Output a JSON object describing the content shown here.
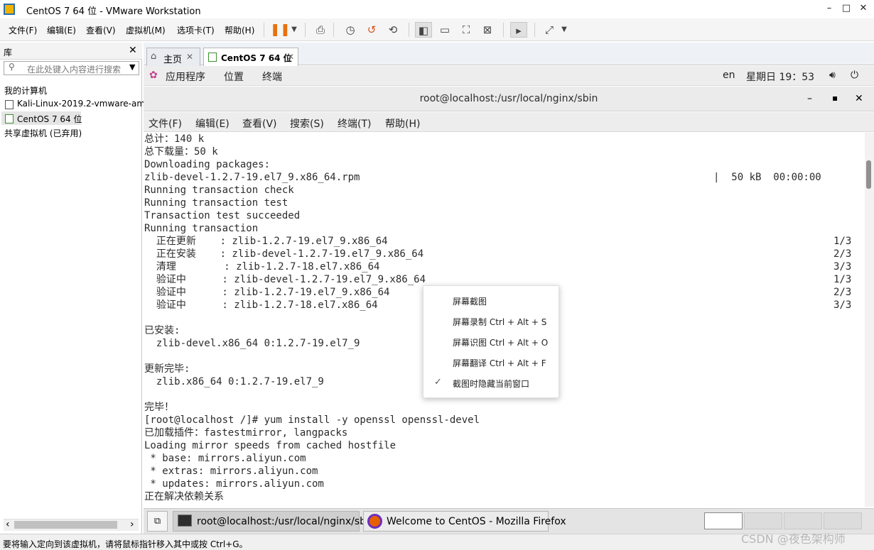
{
  "window": {
    "title": "CentOS 7 64 位 - VMware Workstation",
    "controls": [
      "–",
      "□",
      "✕"
    ]
  },
  "menubar": [
    "文件(F)",
    "编辑(E)",
    "查看(V)",
    "虚拟机(M)",
    "选项卡(T)",
    "帮助(H)"
  ],
  "library": {
    "title": "库",
    "close": "✕",
    "search_placeholder": "在此处键入内容进行搜索",
    "search_arrow": "▼",
    "items": [
      "我的计算机",
      "Kali-Linux-2019.2-vmware-am",
      "CentOS 7 64 位",
      "共享虚拟机 (已弃用)"
    ],
    "scroll_left": "‹",
    "scroll_right": "›"
  },
  "tabs": [
    {
      "label": "主页",
      "icon": "home-icon"
    },
    {
      "label": "CentOS 7 64 位",
      "icon": "vm-icon"
    }
  ],
  "gnome_bar": {
    "apps": "应用程序",
    "places": "位置",
    "terminal": "终端",
    "lang": "en",
    "clock": "星期日 19：53"
  },
  "terminal": {
    "title": "root@localhost:/usr/local/nginx/sbin",
    "controls": [
      "–",
      "▪",
      "✕"
    ],
    "menu": [
      "文件(F)",
      "编辑(E)",
      "查看(V)",
      "搜索(S)",
      "终端(T)",
      "帮助(H)"
    ],
    "lines": [
      "总计：140 k",
      "总下载量：50 k",
      "Downloading packages:",
      "zlib-devel-1.2.7-19.el7_9.x86_64.rpm",
      "Running transaction check",
      "Running transaction test",
      "Transaction test succeeded",
      "Running transaction",
      "  正在更新    : zlib-1.2.7-19.el7_9.x86_64",
      "  正在安装    : zlib-devel-1.2.7-19.el7_9.x86_64",
      "  清理        : zlib-1.2.7-18.el7.x86_64",
      "  验证中      : zlib-devel-1.2.7-19.el7_9.x86_64",
      "  验证中      : zlib-1.2.7-19.el7_9.x86_64",
      "  验证中      : zlib-1.2.7-18.el7.x86_64",
      "",
      "已安装:",
      "  zlib-devel.x86_64 0:1.2.7-19.el7_9",
      "",
      "更新完毕:",
      "  zlib.x86_64 0:1.2.7-19.el7_9",
      "",
      "完毕！",
      "[root@localhost /]# yum install -y openssl openssl-devel",
      "已加载插件：fastestmirror, langpacks",
      "Loading mirror speeds from cached hostfile",
      " * base: mirrors.aliyun.com",
      " * extras: mirrors.aliyun.com",
      " * updates: mirrors.aliyun.com",
      "正在解决依赖关系"
    ],
    "download_stats": "|  50 kB  00:00:00",
    "progress": [
      "1/3",
      "2/3",
      "3/3",
      "1/3",
      "2/3",
      "3/3"
    ]
  },
  "context_menu": {
    "items": [
      "屏幕截图",
      "屏幕录制 Ctrl + Alt + S",
      "屏幕识图 Ctrl + Alt + O",
      "屏幕翻译 Ctrl + Alt + F",
      "截图时隐藏当前窗口"
    ],
    "checked_mark": "✓"
  },
  "taskbar": {
    "tasks": [
      "root@localhost:/usr/local/nginx/sbin",
      "Welcome to CentOS - Mozilla Firefox"
    ]
  },
  "statusbar": {
    "text": "要将输入定向到该虚拟机，请将鼠标指针移入其中或按 Ctrl+G。",
    "watermark": "CSDN @夜色架构师"
  },
  "colors": {
    "accent": "#e8700e",
    "selection": "#e5e5e5"
  }
}
